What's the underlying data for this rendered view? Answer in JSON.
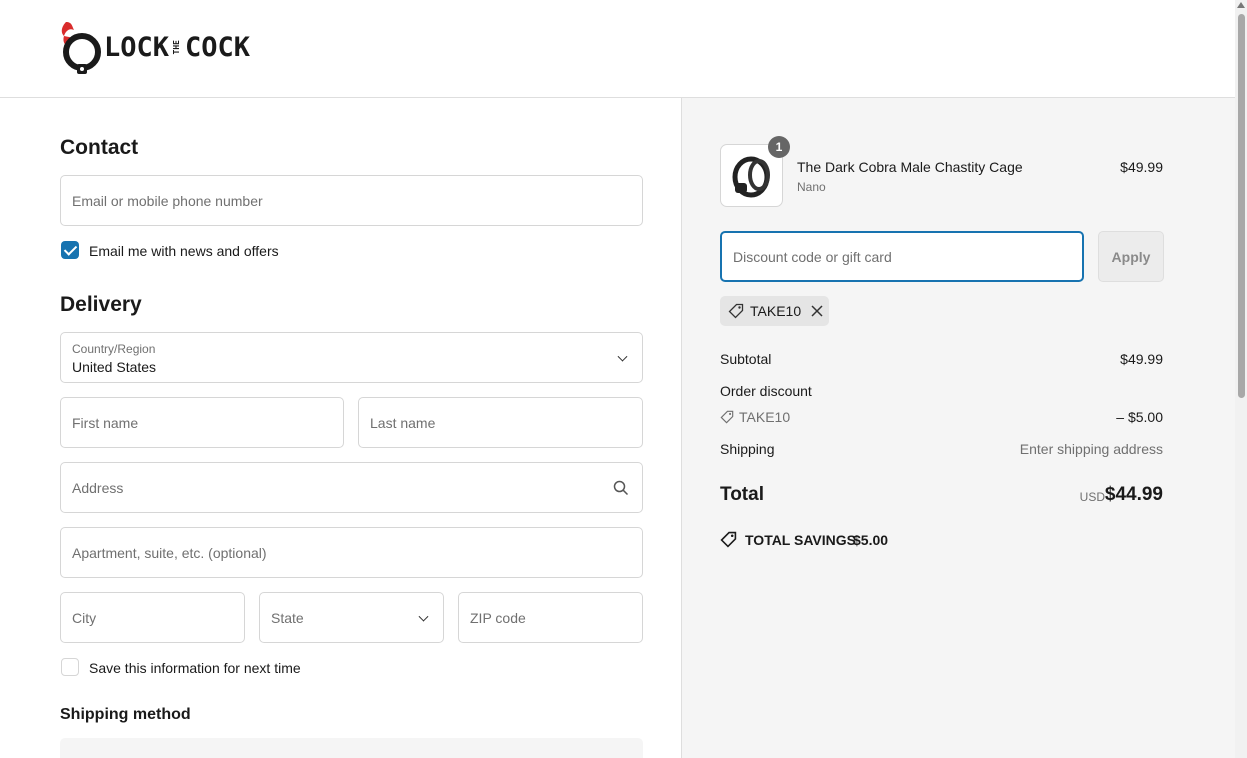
{
  "brand": {
    "name_left": "LOCK",
    "name_mid": "THE",
    "name_right": "COCK",
    "accent_color": "#d92c2c"
  },
  "contact": {
    "heading": "Contact",
    "email_placeholder": "Email or mobile phone number",
    "news_label": "Email me with news and offers",
    "news_checked": true
  },
  "delivery": {
    "heading": "Delivery",
    "country_label": "Country/Region",
    "country_value": "United States",
    "first_name_placeholder": "First name",
    "last_name_placeholder": "Last name",
    "address_placeholder": "Address",
    "apartment_placeholder": "Apartment, suite, etc. (optional)",
    "city_placeholder": "City",
    "state_placeholder": "State",
    "zip_placeholder": "ZIP code",
    "save_label": "Save this information for next time",
    "save_checked": false
  },
  "shipping_method": {
    "heading": "Shipping method"
  },
  "summary": {
    "product": {
      "name": "The Dark Cobra Male Chastity Cage",
      "variant": "Nano",
      "price": "$49.99",
      "quantity": "1"
    },
    "discount_placeholder": "Discount code or gift card",
    "apply_label": "Apply",
    "applied_code": "TAKE10",
    "subtotal_label": "Subtotal",
    "subtotal_value": "$49.99",
    "order_discount_label": "Order discount",
    "discount_code": "TAKE10",
    "discount_value": "– $5.00",
    "shipping_label": "Shipping",
    "shipping_value": "Enter shipping address",
    "total_label": "Total",
    "currency": "USD",
    "total_value": "$44.99",
    "savings_label": "TOTAL SAVINGS",
    "savings_value": "$5.00"
  },
  "colors": {
    "primary": "#1773b0",
    "summary_bg": "#f5f5f5"
  }
}
